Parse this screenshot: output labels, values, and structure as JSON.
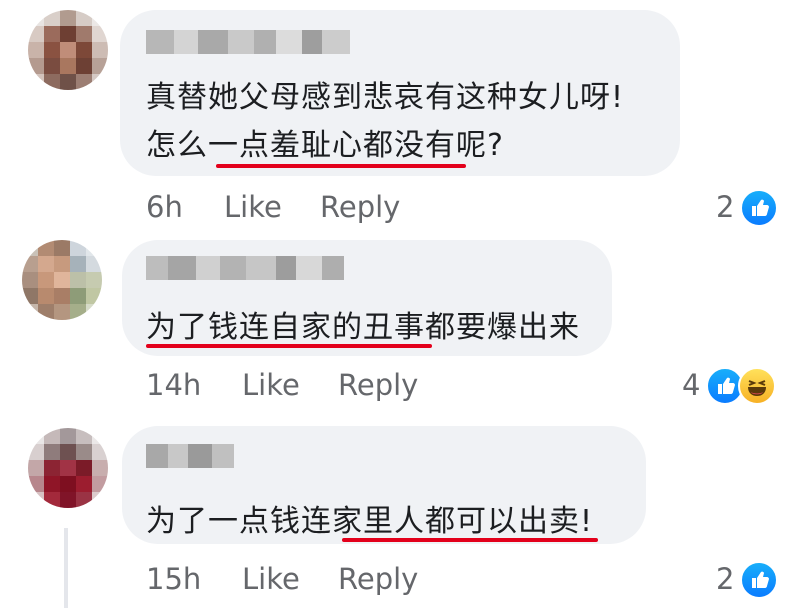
{
  "comments": [
    {
      "text_line1": "真替她父母感到悲哀有这种女儿呀!",
      "text_line2": "怎么一点羞耻心都没有呢?",
      "time": "6h",
      "like": "Like",
      "reply": "Reply",
      "reaction_count": "2",
      "reactions": [
        "like-icon"
      ]
    },
    {
      "text_line1": "为了钱连自家的丑事都要爆出来",
      "time": "14h",
      "like": "Like",
      "reply": "Reply",
      "reaction_count": "4",
      "reactions": [
        "like-icon",
        "haha-icon"
      ]
    },
    {
      "text_line1": "为了一点钱连家里人都可以出卖!",
      "time": "15h",
      "like": "Like",
      "reply": "Reply",
      "reaction_count": "2",
      "reactions": [
        "like-icon"
      ]
    }
  ],
  "colors": {
    "bubble": "#f0f2f5",
    "underline": "#e3001b",
    "like_blue": "#0a7cff",
    "meta_text": "#65676b"
  }
}
